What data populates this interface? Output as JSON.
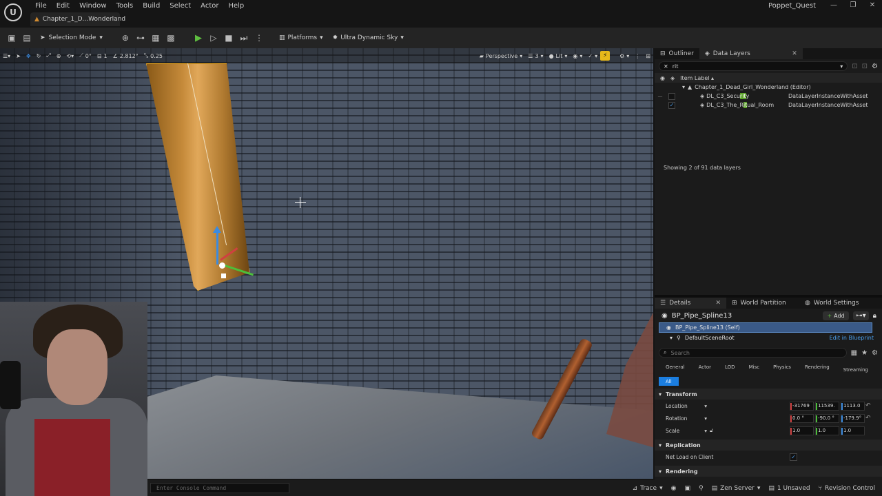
{
  "menu": [
    "File",
    "Edit",
    "Window",
    "Tools",
    "Build",
    "Select",
    "Actor",
    "Help"
  ],
  "doc_tab": "Chapter_1_D...Wonderland",
  "project_name": "Poppet_Quest",
  "toolbar": {
    "selection_mode": "Selection Mode",
    "platforms": "Platforms",
    "sky": "Ultra Dynamic Sky"
  },
  "viewport_toolbar": {
    "rotation_snap": "0°",
    "grid_snap": "1",
    "scale_value": "2.812°",
    "cam_speed": "0.25",
    "view_mode": "Perspective",
    "cam_number": "3",
    "lit": "Lit"
  },
  "outliner": {
    "tab_outliner": "Outliner",
    "tab_data_layers": "Data Layers",
    "search_value": "rit",
    "column_item_label": "Item Label",
    "root": "Chapter_1_Dead_Girl_Wonderland (Editor)",
    "rows": [
      {
        "name_pre": "DL_C3_Secu",
        "name_hl": "rit",
        "name_post": "y",
        "type": "DataLayerInstanceWithAsset",
        "checked": false
      },
      {
        "name_pre": "DL_C3_The_R",
        "name_hl": "it",
        "name_post": "ual_Room",
        "type": "DataLayerInstanceWithAsset",
        "checked": true
      }
    ],
    "showing": "Showing 2 of 91 data layers"
  },
  "details": {
    "tab_details": "Details",
    "tab_world_partition": "World Partition",
    "tab_world_settings": "World Settings",
    "actor_name": "BP_Pipe_Spline13",
    "add_label": "Add",
    "self_component": "BP_Pipe_Spline13 (Self)",
    "root_component": "DefaultSceneRoot",
    "edit_blueprint": "Edit in Blueprint",
    "search_placeholder": "Search",
    "categories": [
      "General",
      "Actor",
      "LOD",
      "Misc",
      "Physics",
      "Rendering",
      "Streaming",
      "All"
    ],
    "transform_label": "Transform",
    "location_label": "Location",
    "location": [
      "-31769",
      "11539.",
      "1113.0"
    ],
    "rotation_label": "Rotation",
    "rotation": [
      "0.0 °",
      "-90.0 °",
      "-179.9°"
    ],
    "scale_label": "Scale",
    "scale": [
      "1.0",
      "1.0",
      "1.0"
    ],
    "replication_label": "Replication",
    "net_load_label": "Net Load on Client",
    "rendering_label": "Rendering"
  },
  "console_placeholder": "Enter Console Command",
  "statusbar": {
    "trace": "Trace",
    "zen": "Zen Server",
    "unsaved": "1 Unsaved",
    "revision": "Revision Control"
  }
}
